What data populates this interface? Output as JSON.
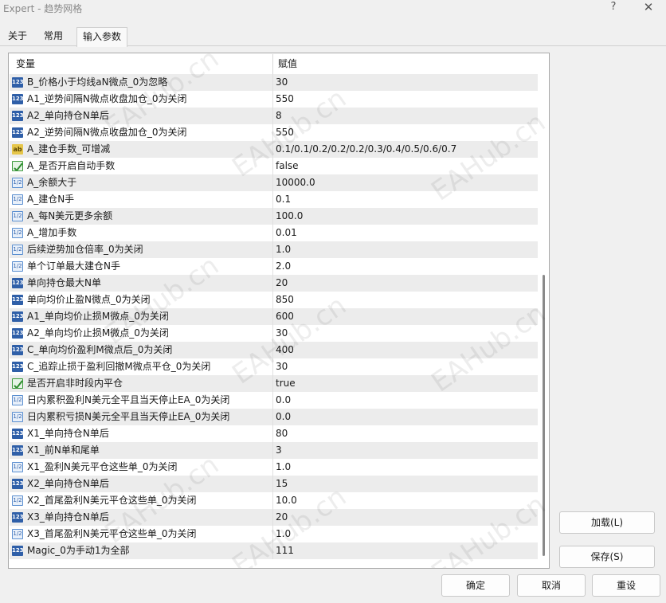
{
  "window": {
    "title": "Expert - 趋势网格",
    "help": "?",
    "close": "✕"
  },
  "tabs": [
    "关于",
    "常用",
    "输入参数"
  ],
  "active_tab": 2,
  "grid": {
    "header_name": "变量",
    "header_value": "赋值",
    "rows": [
      {
        "type": "int",
        "name": "B_价格小于均线aN微点_0为忽略",
        "value": "30"
      },
      {
        "type": "int",
        "name": "A1_逆势间隔N微点收盘加仓_0为关闭",
        "value": "550"
      },
      {
        "type": "int",
        "name": "A2_单向持仓N单后",
        "value": "8"
      },
      {
        "type": "int",
        "name": "A2_逆势间隔N微点收盘加仓_0为关闭",
        "value": "550"
      },
      {
        "type": "str",
        "name": "A_建仓手数_可增减",
        "value": "0.1/0.1/0.2/0.2/0.2/0.3/0.4/0.5/0.6/0.7"
      },
      {
        "type": "bool",
        "name": "A_是否开启自动手数",
        "value": "false"
      },
      {
        "type": "dbl",
        "name": "A_余额大于",
        "value": "10000.0"
      },
      {
        "type": "dbl",
        "name": "A_建仓N手",
        "value": "0.1"
      },
      {
        "type": "dbl",
        "name": "A_每N美元更多余额",
        "value": "100.0"
      },
      {
        "type": "dbl",
        "name": "A_增加手数",
        "value": "0.01"
      },
      {
        "type": "dbl",
        "name": "后续逆势加仓倍率_0为关闭",
        "value": "1.0"
      },
      {
        "type": "dbl",
        "name": "单个订单最大建仓N手",
        "value": "2.0"
      },
      {
        "type": "int",
        "name": "单向持仓最大N单",
        "value": "20"
      },
      {
        "type": "int",
        "name": "单向均价止盈N微点_0为关闭",
        "value": "850"
      },
      {
        "type": "int",
        "name": "A1_单向均价止损M微点_0为关闭",
        "value": "600"
      },
      {
        "type": "int",
        "name": "A2_单向均价止损M微点_0为关闭",
        "value": "30"
      },
      {
        "type": "int",
        "name": "C_单向均价盈利M微点后_0为关闭",
        "value": "400"
      },
      {
        "type": "int",
        "name": "C_追踪止损于盈利回撤M微点平仓_0为关闭",
        "value": "30"
      },
      {
        "type": "bool",
        "name": "是否开启非时段内平仓",
        "value": "true"
      },
      {
        "type": "dbl",
        "name": "日内累积盈利N美元全平且当天停止EA_0为关闭",
        "value": "0.0"
      },
      {
        "type": "dbl",
        "name": "日内累积亏损N美元全平且当天停止EA_0为关闭",
        "value": "0.0"
      },
      {
        "type": "int",
        "name": "X1_单向持仓N单后",
        "value": "80"
      },
      {
        "type": "int",
        "name": "X1_前N单和尾单",
        "value": "3"
      },
      {
        "type": "dbl",
        "name": "X1_盈利N美元平仓这些单_0为关闭",
        "value": "1.0"
      },
      {
        "type": "int",
        "name": "X2_单向持仓N单后",
        "value": "15"
      },
      {
        "type": "dbl",
        "name": "X2_首尾盈利N美元平仓这些单_0为关闭",
        "value": "10.0"
      },
      {
        "type": "int",
        "name": "X3_单向持仓N单后",
        "value": "20"
      },
      {
        "type": "dbl",
        "name": "X3_首尾盈利N美元平仓这些单_0为关闭",
        "value": "1.0"
      },
      {
        "type": "int",
        "name": "Magic_0为手动1为全部",
        "value": "111"
      }
    ]
  },
  "icon_glyphs": {
    "int": "123",
    "dbl": "1/2",
    "str": "ab",
    "bool": "check-icon"
  },
  "buttons": {
    "load": "加载(L)",
    "save": "保存(S)",
    "ok": "确定",
    "cancel": "取消",
    "reset": "重设"
  },
  "watermark": "EAHub.cn"
}
